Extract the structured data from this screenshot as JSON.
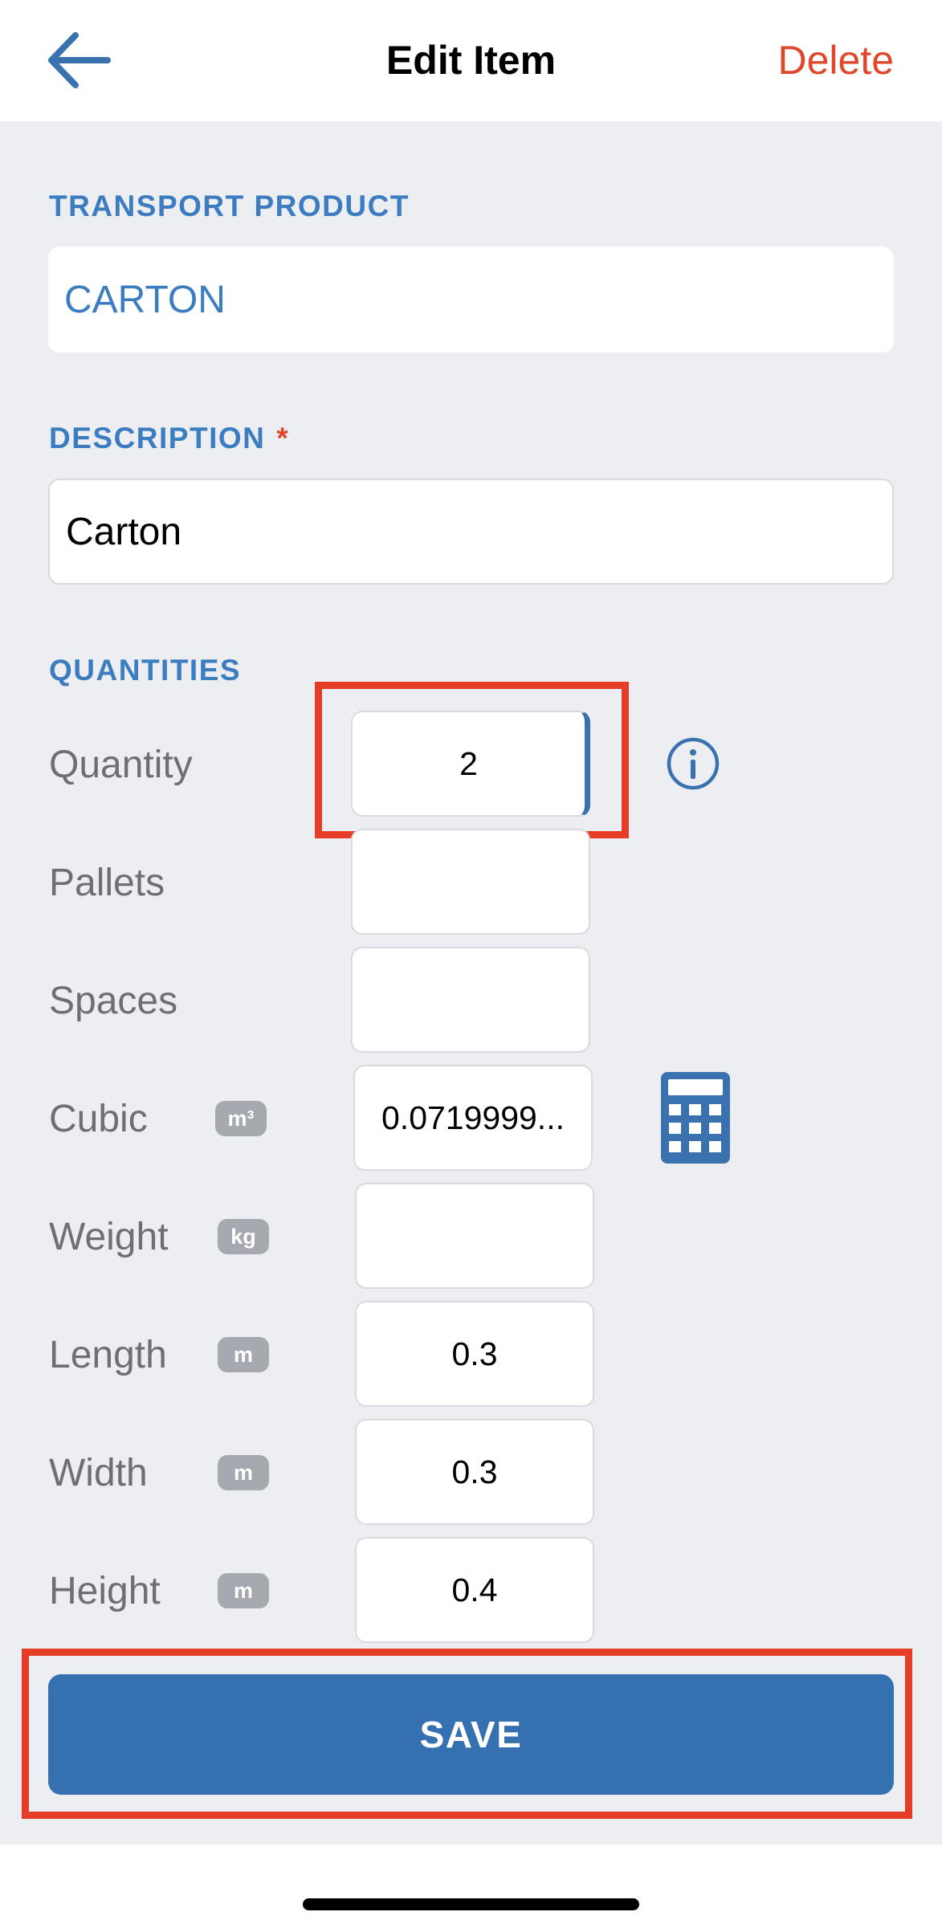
{
  "header": {
    "title": "Edit Item",
    "delete_label": "Delete",
    "back_icon": "arrow-left-icon"
  },
  "transport_product": {
    "label": "TRANSPORT PRODUCT",
    "value": "CARTON"
  },
  "description": {
    "label": "DESCRIPTION",
    "required_mark": "*",
    "value": "Carton"
  },
  "quantities": {
    "label": "QUANTITIES",
    "rows": [
      {
        "label": "Quantity",
        "unit": "",
        "value": "2"
      },
      {
        "label": "Pallets",
        "unit": "",
        "value": ""
      },
      {
        "label": "Spaces",
        "unit": "",
        "value": ""
      },
      {
        "label": "Cubic",
        "unit": "m³",
        "value": "0.0719999..."
      },
      {
        "label": "Weight",
        "unit": "kg",
        "value": ""
      },
      {
        "label": "Length",
        "unit": "m",
        "value": "0.3"
      },
      {
        "label": "Width",
        "unit": "m",
        "value": "0.3"
      },
      {
        "label": "Height",
        "unit": "m",
        "value": "0.4"
      }
    ],
    "info_icon": "info-circle-icon",
    "calculator_icon": "calculator-icon"
  },
  "save": {
    "label": "SAVE"
  },
  "colors": {
    "accent": "#3570b0",
    "label_blue": "#3b7dc0",
    "danger": "#e0472a",
    "highlight": "#e53d28",
    "background": "#edeef1"
  }
}
